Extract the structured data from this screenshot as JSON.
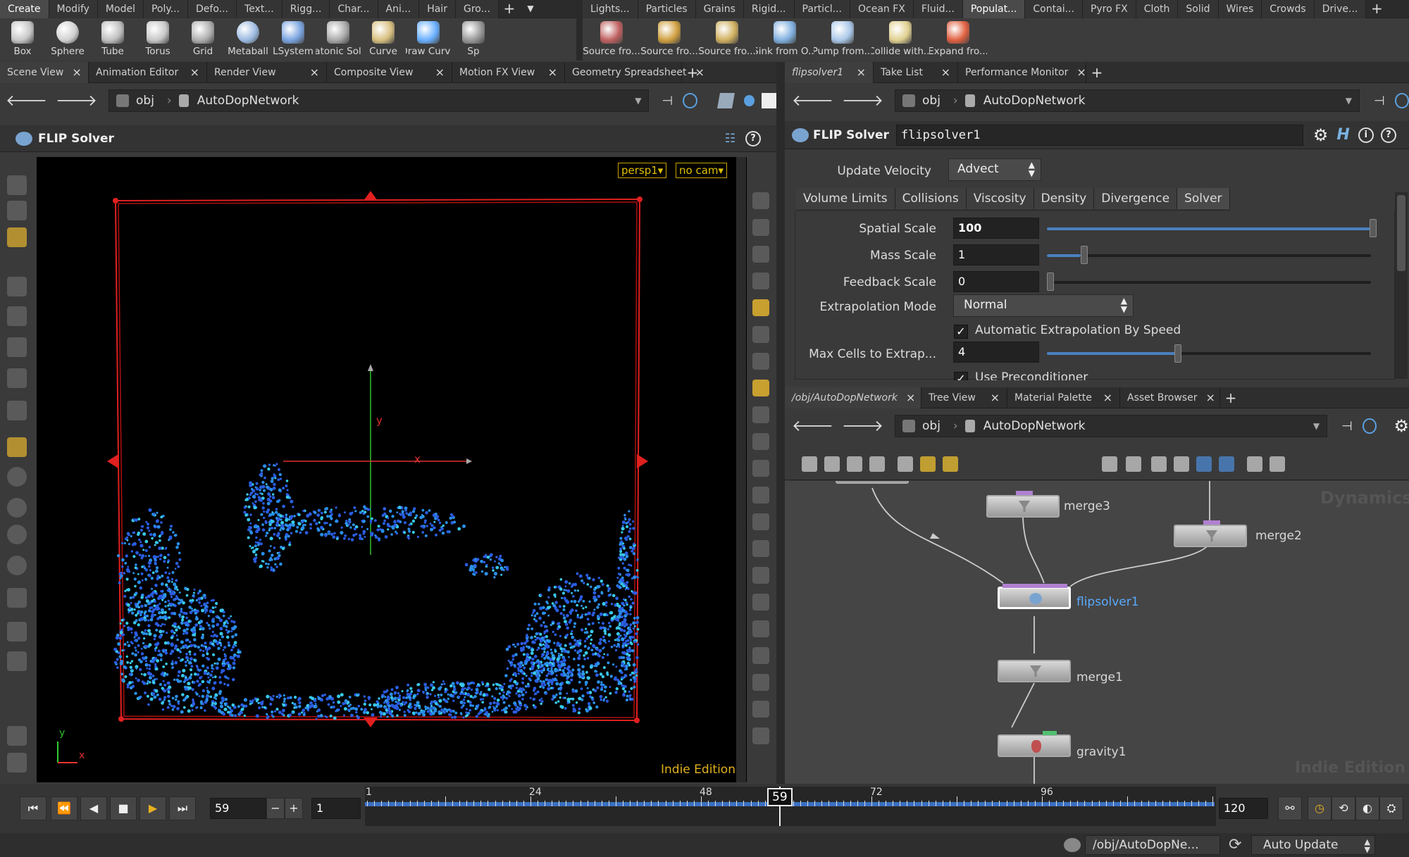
{
  "shelf_left": {
    "tabs": [
      "Create",
      "Modify",
      "Model",
      "Poly...",
      "Defo...",
      "Text...",
      "Rigg...",
      "Char...",
      "Ani...",
      "Hair",
      "Gro..."
    ],
    "tools": [
      {
        "label": "Box",
        "icon": "box-icon"
      },
      {
        "label": "Sphere",
        "icon": "sphere-icon"
      },
      {
        "label": "Tube",
        "icon": "tube-icon"
      },
      {
        "label": "Torus",
        "icon": "torus-icon"
      },
      {
        "label": "Grid",
        "icon": "grid-icon"
      },
      {
        "label": "Metaball",
        "icon": "metaball-icon"
      },
      {
        "label": "LSystem",
        "icon": "lsystem-icon"
      },
      {
        "label": "Platonic Sol...",
        "icon": "platonic-icon"
      },
      {
        "label": "Curve",
        "icon": "curve-icon"
      },
      {
        "label": "Draw Curve",
        "icon": "draw-curve-icon"
      },
      {
        "label": "Sp",
        "icon": "spray-icon"
      }
    ]
  },
  "shelf_right": {
    "tabs": [
      "Lights...",
      "Particles",
      "Grains",
      "Rigid...",
      "Particl...",
      "Ocean FX",
      "Fluid...",
      "Populat...",
      "Contai...",
      "Pyro FX",
      "Cloth",
      "Solid",
      "Wires",
      "Crowds",
      "Drive..."
    ],
    "active_tab": "Populat...",
    "tools": [
      {
        "label": "Source fro...",
        "icon": "source-icon"
      },
      {
        "label": "Source fro...",
        "icon": "source-particles-icon"
      },
      {
        "label": "Source fro...",
        "icon": "source-volume-icon"
      },
      {
        "label": "Sink from O...",
        "icon": "sink-icon"
      },
      {
        "label": "Pump from...",
        "icon": "pump-icon"
      },
      {
        "label": "Collide with...",
        "icon": "collide-icon"
      },
      {
        "label": "Expand fro...",
        "icon": "expand-icon"
      }
    ]
  },
  "left_pane": {
    "tabs": [
      "Scene View",
      "Animation Editor",
      "Render View",
      "Composite View",
      "Motion FX View",
      "Geometry Spreadsheet"
    ],
    "path_root": "obj",
    "path_node": "AutoDopNetwork",
    "title": "FLIP Solver",
    "camera": "persp1▾",
    "cam_mode": "no cam▾",
    "watermark": "Indie Edition",
    "axis_x": "x",
    "axis_y": "y"
  },
  "param_pane": {
    "tabs": [
      "flipsolver1",
      "Take List",
      "Performance Monitor"
    ],
    "path_root": "obj",
    "path_node": "AutoDopNetwork",
    "node_type": "FLIP Solver",
    "node_name": "flipsolver1",
    "update_velocity_label": "Update Velocity",
    "update_velocity_value": "Advect",
    "subtabs": [
      "Volume Limits",
      "Collisions",
      "Viscosity",
      "Density",
      "Divergence",
      "Solver"
    ],
    "params": [
      {
        "label": "Spatial Scale",
        "value": "100"
      },
      {
        "label": "Mass Scale",
        "value": "1"
      },
      {
        "label": "Feedback Scale",
        "value": "0"
      }
    ],
    "extrap_label": "Extrapolation Mode",
    "extrap_value": "Normal",
    "auto_extrap_label": "Automatic Extrapolation By Speed",
    "max_cells_label": "Max Cells to Extrap...",
    "max_cells_value": "4",
    "precond_label": "Use Preconditioner"
  },
  "network_pane": {
    "tabs": [
      "/obj/AutoDopNetwork",
      "Tree View",
      "Material Palette",
      "Asset Browser"
    ],
    "path_root": "obj",
    "path_node": "AutoDopNetwork",
    "context_label": "Dynamics",
    "watermark": "Indie Edition",
    "nodes": [
      "merge3",
      "merge2",
      "flipsolver1",
      "merge1",
      "gravity1"
    ]
  },
  "timeline": {
    "current_frame": "59",
    "start_frame": "1",
    "end_frame": "120",
    "ticks": [
      "1",
      "24",
      "48",
      "72",
      "96"
    ],
    "marker": "59"
  },
  "status": {
    "path": "/obj/AutoDopNe...",
    "update_mode": "Auto Update"
  }
}
